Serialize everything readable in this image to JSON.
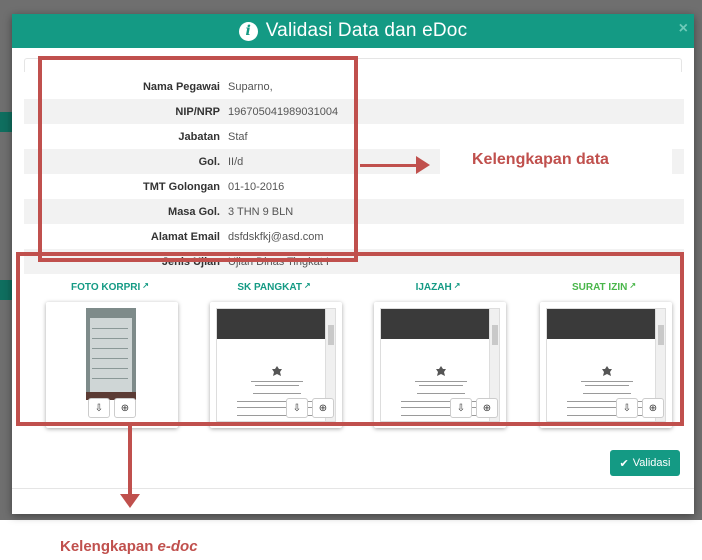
{
  "modal": {
    "title": "Validasi Data dan eDoc",
    "close_glyph": "×"
  },
  "fields": [
    {
      "label": "Nama Pegawai",
      "value": "Suparno,"
    },
    {
      "label": "NIP/NRP",
      "value": "196705041989031004"
    },
    {
      "label": "Jabatan",
      "value": "Staf"
    },
    {
      "label": "Gol.",
      "value": "II/d"
    },
    {
      "label": "TMT Golongan",
      "value": "01-10-2016"
    },
    {
      "label": "Masa Gol.",
      "value": "3 THN 9 BLN"
    },
    {
      "label": "Alamat Email",
      "value": "dsfdskfkj@asd.com"
    },
    {
      "label": "Jenis Ujian",
      "value": "Ujian Dinas Tingkat I"
    }
  ],
  "documents": [
    {
      "title": "FOTO KORPRI",
      "kind": "photo"
    },
    {
      "title": "SK PANGKAT",
      "kind": "pdf"
    },
    {
      "title": "IJAZAH",
      "kind": "pdf"
    },
    {
      "title": "SURAT IZIN",
      "kind": "pdf"
    }
  ],
  "icons": {
    "info": "info-icon",
    "external_link": "external-link-icon",
    "download": "download-icon",
    "zoom": "zoom-icon",
    "check": "check-icon"
  },
  "footer": {
    "validasi_label": "Validasi"
  },
  "annotations": {
    "data_label": "Kelengkapan data",
    "edoc_label_prefix": "Kelengkapan ",
    "edoc_label_em": "e-doc"
  },
  "colors": {
    "header": "#149a84",
    "annotation_red": "#c0504d",
    "link_teal": "#149a84",
    "link_green": "#49b64a"
  }
}
